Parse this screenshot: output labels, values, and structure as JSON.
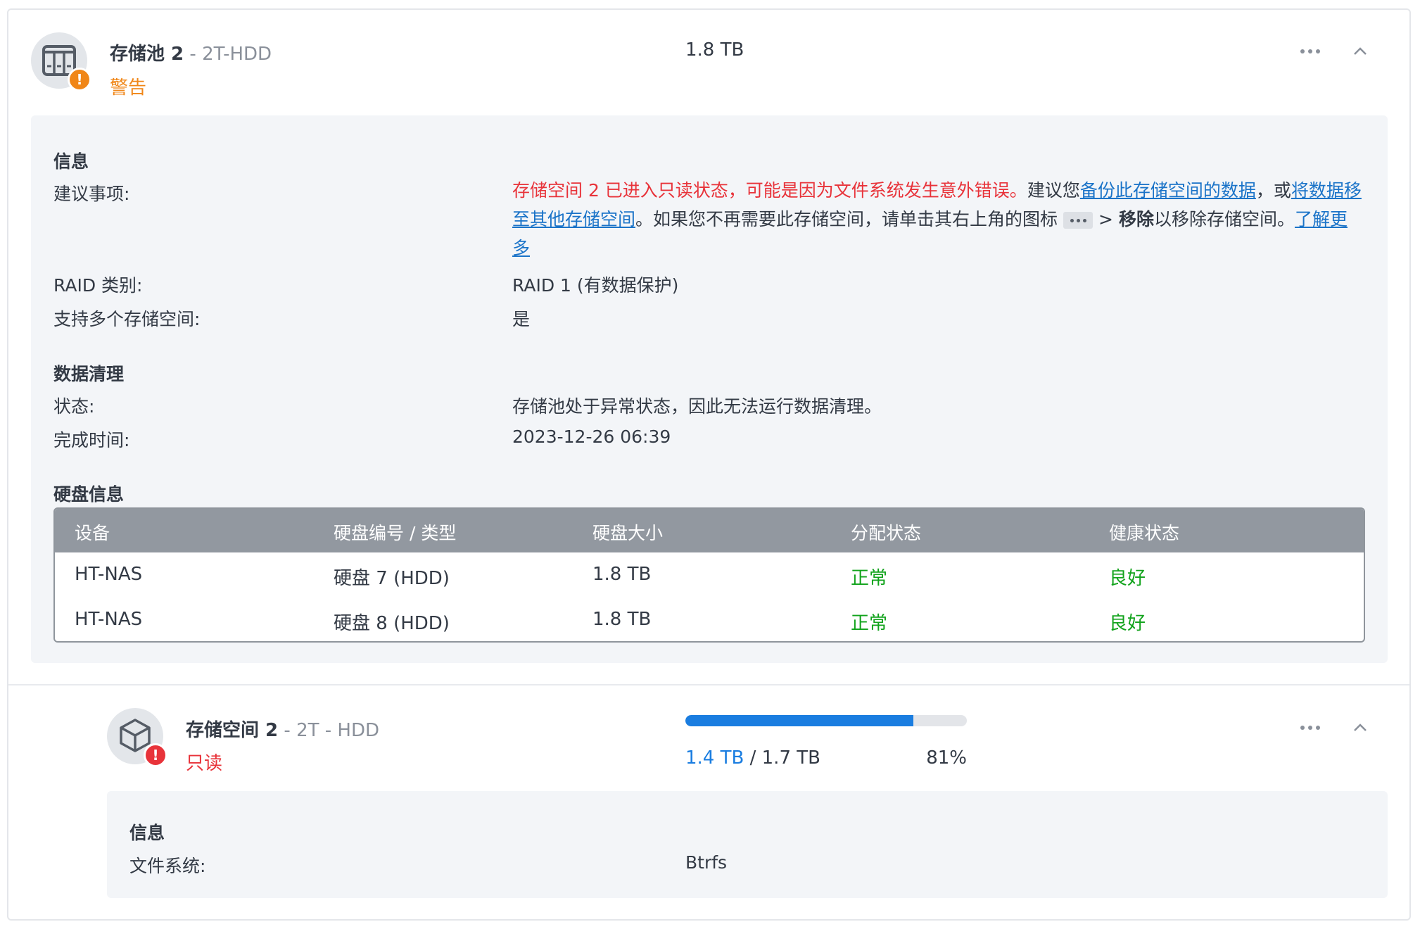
{
  "pool": {
    "name": "存储池 2",
    "subtitle": " - 2T-HDD",
    "status": "警告",
    "size": "1.8 TB",
    "icon": "storage-pool-icon",
    "status_color": "#f08617"
  },
  "info": {
    "section_title": "信息",
    "advice_label": "建议事项:",
    "advice": {
      "red_text": "存储空间 2 已进入只读状态，可能是因为文件系统发生意外错误。",
      "text1": "建议您",
      "link1": "备份此存储空间的数据",
      "text2": "，或",
      "link2": "将数据移至其他存储空间",
      "text3": "。如果您不再需要此存储空间，请单击其右上角的图标",
      "text4": "> ",
      "bold": "移除",
      "text5": "以移除存储空间。",
      "link3": "了解更多"
    },
    "raid_label": "RAID 类别:",
    "raid_value": "RAID 1 (有数据保护)",
    "multi_label": "支持多个存储空间:",
    "multi_value": "是"
  },
  "scrub": {
    "section_title": "数据清理",
    "status_label": "状态:",
    "status_value": "存储池处于异常状态，因此无法运行数据清理。",
    "time_label": "完成时间:",
    "time_value": "2023-12-26 06:39"
  },
  "disks": {
    "section_title": "硬盘信息",
    "columns": [
      "设备",
      "硬盘编号 / 类型",
      "硬盘大小",
      "分配状态",
      "健康状态"
    ],
    "rows": [
      [
        "HT-NAS",
        "硬盘 7 (HDD)",
        "1.8 TB",
        "正常",
        "良好"
      ],
      [
        "HT-NAS",
        "硬盘 8 (HDD)",
        "1.8 TB",
        "正常",
        "良好"
      ]
    ],
    "ok_color": "#12a31c"
  },
  "volume": {
    "name": "存储空间 2",
    "subtitle": " - 2T - HDD",
    "status": "只读",
    "status_color": "#e8333a",
    "icon": "volume-cube-icon",
    "used": "1.4 TB",
    "separator": " / ",
    "total": "1.7 TB",
    "percent": "81%",
    "usage_fraction": 0.81,
    "accent": "#1a7de0",
    "info_title": "信息",
    "fs_label": "文件系统:",
    "fs_value": "Btrfs"
  }
}
